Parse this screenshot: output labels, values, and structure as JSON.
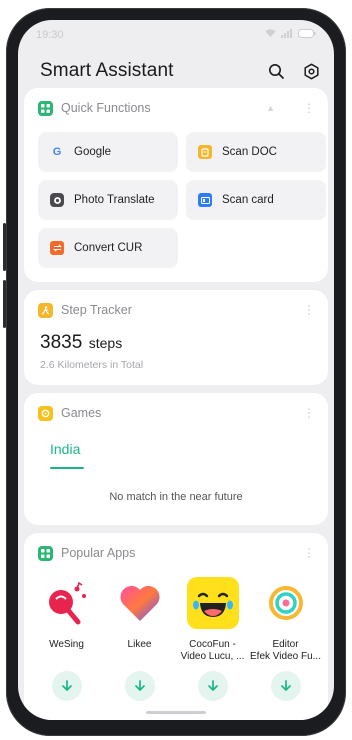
{
  "status": {
    "time": "19:30"
  },
  "header": {
    "title": "Smart Assistant",
    "search_icon": "search-icon",
    "settings_icon": "settings-icon"
  },
  "quick_functions": {
    "title": "Quick Functions",
    "accent": "#2bb673",
    "items": [
      {
        "label": "Google",
        "icon": "google-icon",
        "color": "#4285f4"
      },
      {
        "label": "Scan DOC",
        "icon": "scan-doc-icon",
        "color": "#f5b62b"
      },
      {
        "label": "Photo Translate",
        "icon": "photo-translate-icon",
        "color": "#4a4a4e"
      },
      {
        "label": "Scan card",
        "icon": "scan-card-icon",
        "color": "#2f7df6"
      },
      {
        "label": "Convert CUR",
        "icon": "convert-currency-icon",
        "color": "#f26b2a"
      }
    ]
  },
  "step_tracker": {
    "title": "Step Tracker",
    "steps": "3835",
    "unit": "steps",
    "subtitle": "2.6  Kilometers in Total",
    "accent": "#f5b62b"
  },
  "games": {
    "title": "Games",
    "tab": "India",
    "empty_text": "No match in the near future",
    "accent": "#f5c21b",
    "tab_color": "#1ab68a"
  },
  "popular_apps": {
    "title": "Popular Apps",
    "accent": "#2bb673",
    "apps": [
      {
        "name_line1": "WeSing",
        "name_line2": "",
        "icon": "wesing-icon"
      },
      {
        "name_line1": "Likee",
        "name_line2": "",
        "icon": "likee-icon"
      },
      {
        "name_line1": "CocoFun -",
        "name_line2": "Video Lucu, ...",
        "icon": "cocofun-icon"
      },
      {
        "name_line1": "Editor",
        "name_line2": "Efek Video Fu...",
        "icon": "editor-icon"
      }
    ]
  }
}
